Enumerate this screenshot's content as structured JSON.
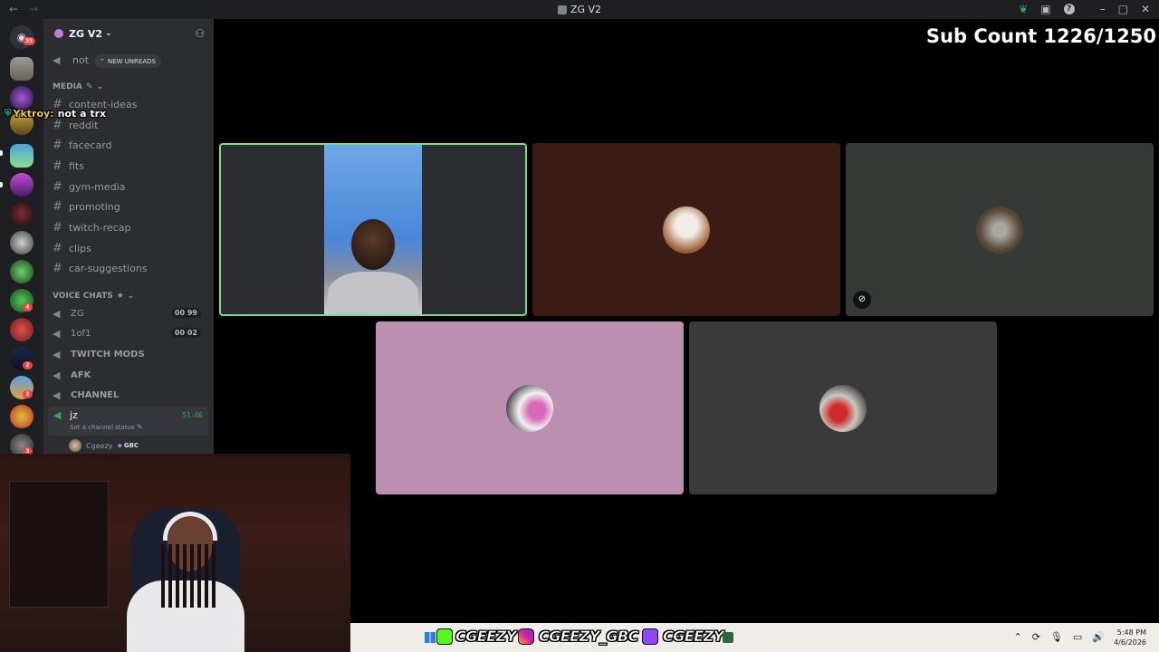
{
  "window": {
    "title": "ZG V2"
  },
  "server": {
    "name": "ZG V2",
    "new_unreads": "NEW UNREADS",
    "partial_channel": "not"
  },
  "categories": {
    "media": "MEDIA",
    "voice": "VOICE CHATS"
  },
  "text_channels": [
    "content-ideas",
    "reddit",
    "facecard",
    "fits",
    "gym-media",
    "promoting",
    "twitch-recap",
    "clips",
    "car-suggestions"
  ],
  "voice_channels": [
    {
      "name": "ZG",
      "count": "00",
      "limit": "99"
    },
    {
      "name": "1of1",
      "count": "00",
      "limit": "02"
    },
    {
      "name": "TWITCH MODS"
    },
    {
      "name": "AFK"
    },
    {
      "name": "CHANNEL"
    }
  ],
  "active_voice": {
    "name": "jz",
    "timer": "51:46",
    "status": "Set a channel status",
    "member": "Cgeezy",
    "member_tag": "GBC"
  },
  "guild_badges": [
    "35",
    "4",
    "2",
    "2",
    "3"
  ],
  "chat_overlay": {
    "user": "Yktroy:",
    "message": "not a trx"
  },
  "stream_overlay": {
    "sub_count": "Sub Count 1226/1250"
  },
  "socials": [
    "CGEEZY",
    "CGEEZY_GBC",
    "CGEEZY"
  ],
  "taskbar": {
    "time": "5:48 PM",
    "date": "4/6/2026"
  },
  "colors": {
    "tile_brown": "#3a1c15",
    "tile_gray": "#363a36",
    "tile_pink": "#bc8fb0",
    "tile_dark": "#3a3a3a",
    "speaking_border": "#7bdc8a",
    "badge_red": "#f23f43"
  }
}
